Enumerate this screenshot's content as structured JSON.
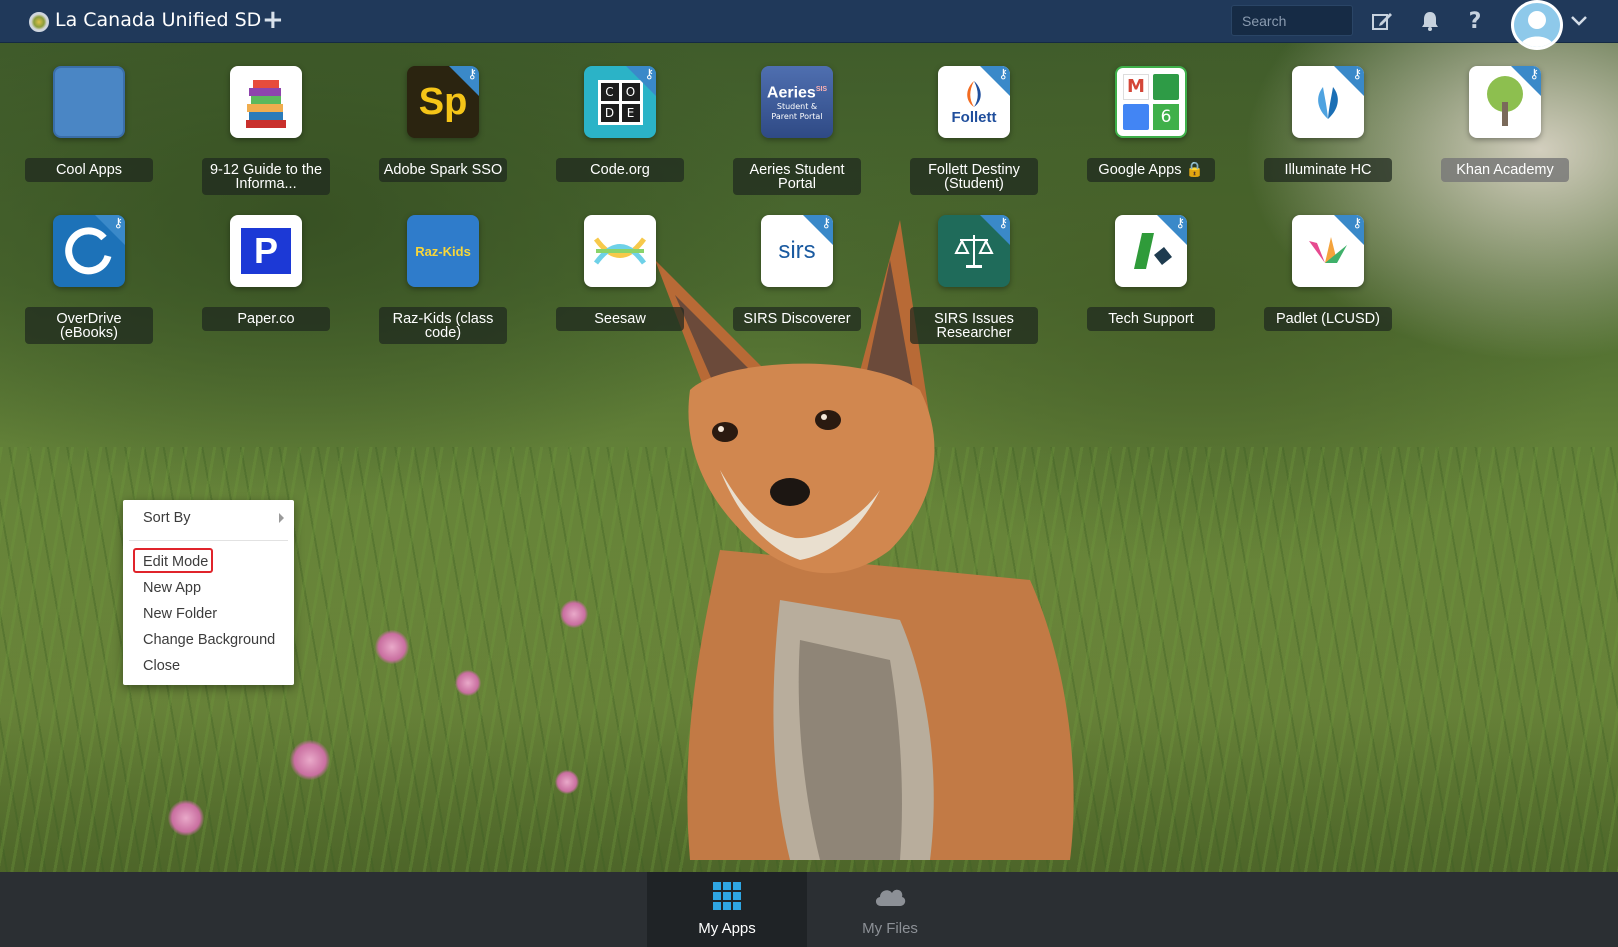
{
  "header": {
    "org_name": "La Canada Unified SD",
    "add_symbol": "+",
    "search_placeholder": "Search"
  },
  "apps": [
    {
      "label": "Cool Apps",
      "icon": "folder-tile",
      "color": "#4a86c5"
    },
    {
      "label": "9-12 Guide to the Informa...",
      "icon": "books-icon",
      "color": "#ffffff"
    },
    {
      "label": "Adobe Spark SSO",
      "icon": "adobe-spark-icon",
      "text": "Sp",
      "color": "#2b2410"
    },
    {
      "label": "Code.org",
      "icon": "code-org-icon",
      "color": "#2bb3c7",
      "grid": [
        "C",
        "O",
        "D",
        "E"
      ]
    },
    {
      "label": "Aeries Student Portal",
      "icon": "aeries-icon",
      "color": "#3d5b9a",
      "title": "Aeries",
      "sub1": "Student &",
      "sub2": "Parent Portal",
      "sis": "SIS"
    },
    {
      "label": "Follett Destiny (Student)",
      "icon": "follett-icon",
      "color": "#ffffff",
      "text": "Follett"
    },
    {
      "label": "Google Apps",
      "icon": "google-apps-icon",
      "color": "#ffffff",
      "count": "6",
      "locked": true
    },
    {
      "label": "Illuminate HC",
      "icon": "illuminate-icon",
      "color": "#ffffff"
    },
    {
      "label": "Khan Academy",
      "icon": "khan-tree-icon",
      "color": "#ffffff",
      "selected": true
    },
    {
      "label": "OverDrive (eBooks)",
      "icon": "overdrive-icon",
      "color": "#1d72b8"
    },
    {
      "label": "Paper.co",
      "icon": "paper-co-icon",
      "color": "#ffffff",
      "text": "P"
    },
    {
      "label": "Raz-Kids (class code)",
      "icon": "raz-kids-icon",
      "color": "#2f7ccb",
      "text": "Raz-Kids"
    },
    {
      "label": "Seesaw",
      "icon": "seesaw-icon",
      "color": "#ffffff"
    },
    {
      "label": "SIRS Discoverer",
      "icon": "sirs-icon",
      "color": "#ffffff",
      "text": "sirs"
    },
    {
      "label": "SIRS Issues Researcher",
      "icon": "scales-icon",
      "color": "#1f6b5a"
    },
    {
      "label": "Tech Support",
      "icon": "tech-support-icon",
      "color": "#ffffff"
    },
    {
      "label": "Padlet (LCUSD)",
      "icon": "padlet-icon",
      "color": "#ffffff"
    }
  ],
  "context_menu": {
    "sort_by": "Sort By",
    "items": [
      "Edit Mode",
      "New App",
      "New Folder",
      "Change Background",
      "Close"
    ]
  },
  "bottom_tabs": [
    {
      "label": "My Apps",
      "icon": "grid-icon",
      "active": true
    },
    {
      "label": "My Files",
      "icon": "cloud-icon",
      "active": false
    }
  ],
  "colors": {
    "topbar": "#20395a",
    "bottombar": "#2b2f33",
    "accent_blue": "#3a89c9",
    "highlight_red": "#e0242b"
  }
}
